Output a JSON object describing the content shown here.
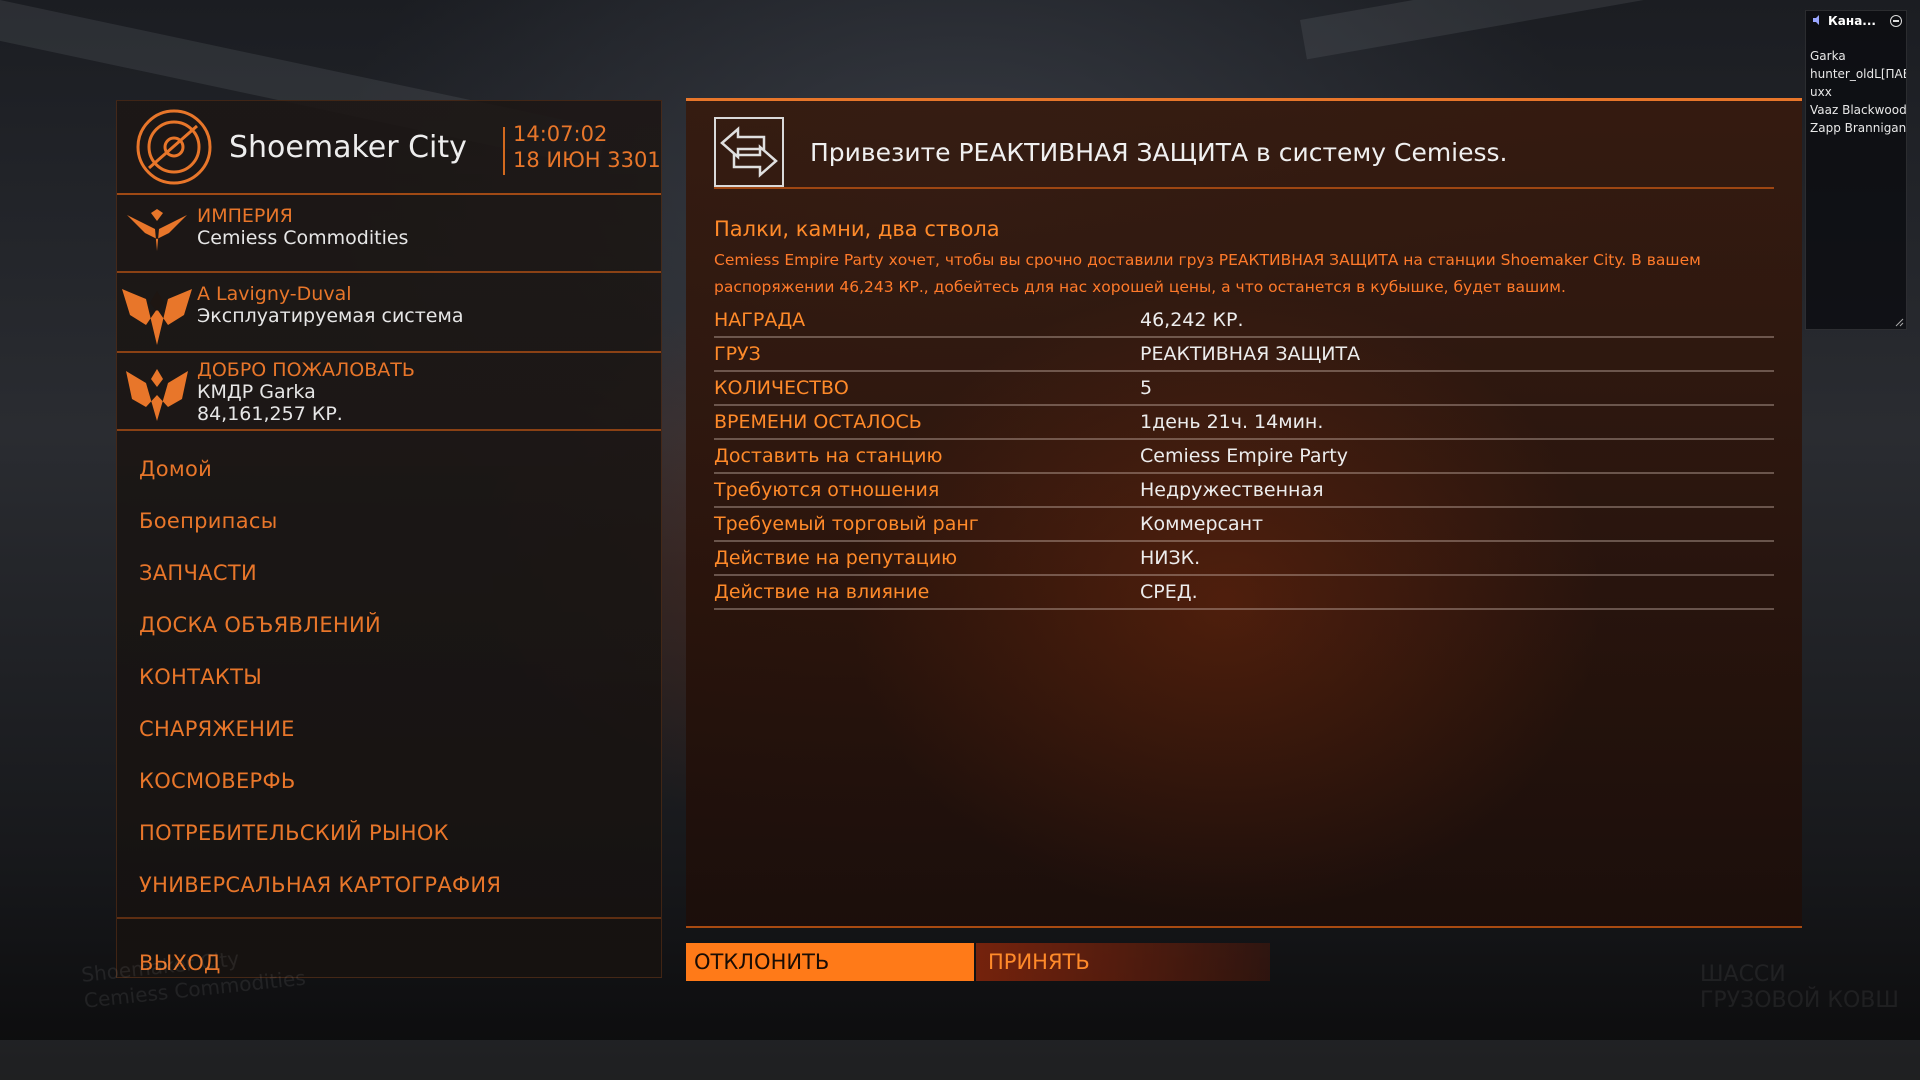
{
  "station": {
    "name": "Shoemaker City",
    "time": "14:07:02",
    "date": "18 ИЮН 3301"
  },
  "faction": {
    "allegiance": "ИМПЕРИЯ",
    "name": "Cemiess Commodities"
  },
  "system": {
    "owner": "A Lavigny-Duval",
    "state": "Эксплуатируемая система"
  },
  "welcome": {
    "greeting": "ДОБРО ПОЖАЛОВАТЬ",
    "commander": "КМДР Garka",
    "credits": "84,161,257 КР."
  },
  "nav": {
    "items": [
      "Домой",
      "Боеприпасы",
      "ЗАПЧАСТИ",
      "ДОСКА ОБЪЯВЛЕНИЙ",
      "КОНТАКТЫ",
      "СНАРЯЖЕНИЕ",
      "КОСМОВЕРФЬ",
      "ПОТРЕБИТЕЛЬСКИЙ РЫНОК",
      "УНИВЕРСАЛЬНАЯ КАРТОГРАФИЯ"
    ],
    "exit": "ВЫХОД"
  },
  "mission": {
    "title": "Привезите РЕАКТИВНАЯ ЗАЩИТА в систему Cemiess.",
    "subtitle": "Палки, камни, два ствола",
    "description": "Cemiess Empire Party хочет, чтобы вы срочно доставили груз РЕАКТИВНАЯ ЗАЩИТА на станции Shoemaker City. В вашем распоряжении 46,243 КР., добейтесь для нас хорошей цены, а что останется в кубышке, будет вашим.",
    "details": [
      {
        "label": "НАГРАДА",
        "value": "46,242 КР."
      },
      {
        "label": "ГРУЗ",
        "value": "РЕАКТИВНАЯ ЗАЩИТА"
      },
      {
        "label": "КОЛИЧЕСТВО",
        "value": "5"
      },
      {
        "label": "ВРЕМЕНИ ОСТАЛОСЬ",
        "value": "1день 21ч. 14мин."
      },
      {
        "label": "Доставить на станцию",
        "value": "Cemiess Empire Party"
      },
      {
        "label": "Требуются отношения",
        "value": "Недружественная"
      },
      {
        "label": "Требуемый торговый ранг",
        "value": "Коммерсант"
      },
      {
        "label": "Действие на репутацию",
        "value": "НИЗК."
      },
      {
        "label": "Действие на влияние",
        "value": "СРЕД."
      }
    ],
    "decline_label": "ОТКЛОНИТЬ",
    "accept_label": "ПРИНЯТЬ"
  },
  "background_hud": {
    "station": "Shoemaker City",
    "faction": "Cemiess Commodities",
    "right_line1": "ШАССИ",
    "right_line2": "ГРУЗОВОЙ КОВШ"
  },
  "chat": {
    "title": "Кана...",
    "users": [
      "Garka",
      "hunter_oldL[ПАЕ",
      "uxx",
      "Vaaz Blackwood",
      "Zapp Brannigan|"
    ]
  },
  "colors": {
    "accent": "#e8762a",
    "accent_bright": "#ff7a18",
    "text_light": "#ececec"
  }
}
